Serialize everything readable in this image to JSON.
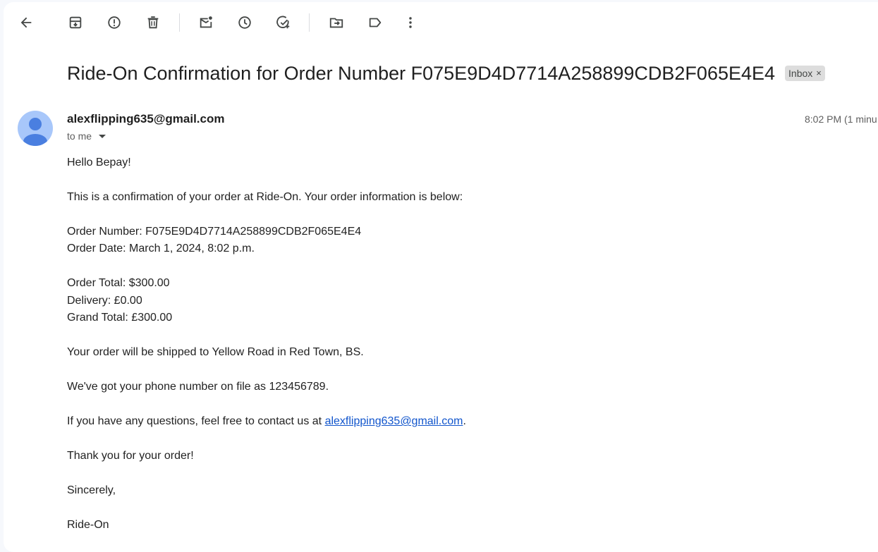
{
  "toolbar": {
    "buttons": [
      {
        "name": "back-icon",
        "tooltip": "Back to Inbox"
      },
      {
        "name": "archive-icon",
        "tooltip": "Archive"
      },
      {
        "name": "report-spam-icon",
        "tooltip": "Report spam"
      },
      {
        "name": "delete-icon",
        "tooltip": "Delete"
      },
      {
        "name": "mark-unread-icon",
        "tooltip": "Mark as unread"
      },
      {
        "name": "snooze-icon",
        "tooltip": "Snooze"
      },
      {
        "name": "add-task-icon",
        "tooltip": "Add to Tasks"
      },
      {
        "name": "move-to-icon",
        "tooltip": "Move to"
      },
      {
        "name": "label-icon",
        "tooltip": "Labels"
      },
      {
        "name": "more-icon",
        "tooltip": "More"
      }
    ]
  },
  "email": {
    "subject": "Ride-On Confirmation for Order Number F075E9D4D7714A258899CDB2F065E4E4",
    "label": "Inbox",
    "label_close": "×",
    "sender": "alexflipping635@gmail.com",
    "recipient": "to me",
    "time": "8:02 PM (1 minu",
    "body": {
      "greeting": "Hello Bepay!",
      "intro": "This is a confirmation of your order at Ride-On. Your order information is below:",
      "order_number": "Order Number: F075E9D4D7714A258899CDB2F065E4E4",
      "order_date": "Order Date: March 1, 2024, 8:02 p.m.",
      "order_total": "Order Total: $300.00",
      "delivery": "Delivery: £0.00",
      "grand_total": "Grand Total: £300.00",
      "shipping": "Your order will be shipped to Yellow Road in Red Town, BS.",
      "phone": "We've got your phone number on file as 123456789.",
      "questions_prefix": "If you have any questions, feel free to contact us at ",
      "questions_link": "alexflipping635@gmail.com",
      "questions_suffix": ".",
      "thanks": "Thank you for your order!",
      "closing": "Sincerely,",
      "signature": "Ride-On"
    }
  },
  "colors": {
    "link": "#1155cc",
    "avatar_bg": "#a8c7fa",
    "avatar_fg": "#4a7fe0",
    "icon": "#444746"
  }
}
